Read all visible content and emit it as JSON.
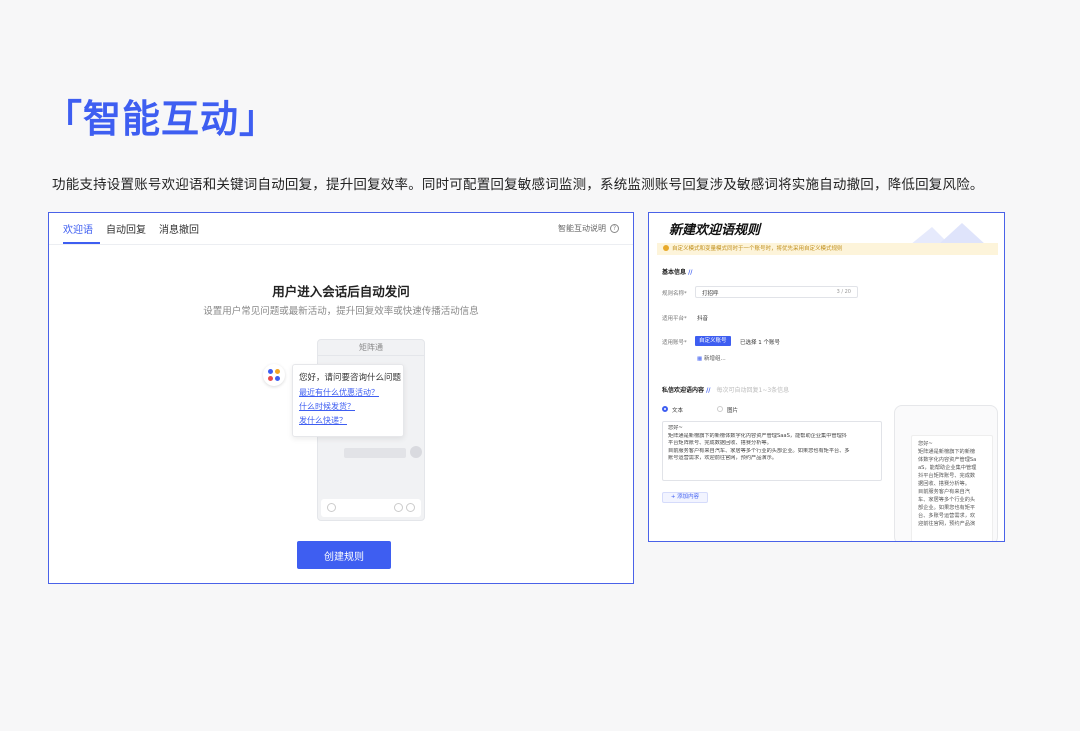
{
  "header": {
    "title": "「智能互动」",
    "description": "功能支持设置账号欢迎语和关键词自动回复，提升回复效率。同时可配置回复敏感词监测，系统监测账号回复涉及敏感词将实施自动撤回，降低回复风险。"
  },
  "left_panel": {
    "tabs": [
      {
        "label": "欢迎语",
        "active": true
      },
      {
        "label": "自动回复",
        "active": false
      },
      {
        "label": "消息撤回",
        "active": false
      }
    ],
    "help_label": "智能互动说明",
    "heading": "用户进入会话后自动发问",
    "subheading": "设置用户常见问题或最新活动，提升回复效率或快速传播活动信息",
    "phone_title": "矩阵通",
    "bubble": {
      "greeting": "您好，请问要咨询什么问题",
      "questions": [
        "最近有什么优惠活动？",
        "什么时候发货？",
        "发什么快递？"
      ]
    },
    "create_button": "创建规则"
  },
  "right_panel": {
    "title": "新建欢迎语规则",
    "notice": "自定义模式和变量模式同时于一个账号时，将优先采用自定义模式规则",
    "basic_info": "基本信息",
    "rule_name_label": "规则名称*",
    "rule_name_value": "打招呼",
    "rule_name_count": "3 / 20",
    "platform_label": "适用平台*",
    "platform_value": "抖音",
    "account_label": "适用账号*",
    "account_chip": "自定义账号",
    "account_selected": "已选择 1 个账号",
    "account_add": "新增组...",
    "content_label": "私信欢迎语内容",
    "content_hint": "每次可自动回复1~3条信息",
    "radio_text": "文本",
    "radio_image": "图片",
    "message_lines": [
      "您好~",
      "矩阵通是新榜旗下的新榜体数字化内容资产管理SaaS，能帮助企业集中管理抖",
      "平台矩阵账号、完成数据回收、搭赛分析等。",
      "目前服务客户有来自汽车、家居等多个行业的头部企业。如果您也有矩平台、多",
      "账号运营需求，欢迎前往官网，预约产品演示。"
    ],
    "add_content_button": "+ 添加内容",
    "preview_lines": [
      "您好~",
      "矩阵通是新榜旗下的新榜",
      "体数字化内容资产管理Sa",
      "aS，能帮助企业集中管理",
      "抖平台矩阵账号、完成数",
      "据回收、搭赛分析等。",
      "目前服务客户有来自汽",
      "车、家居等多个行业的头",
      "部企业。如果您也有矩平",
      "台、多账号运营需求，欢",
      "迎前往官网，预约产品演"
    ]
  },
  "colors": {
    "accent": "#3e5ef1",
    "notice_bg": "#fdf4da"
  }
}
